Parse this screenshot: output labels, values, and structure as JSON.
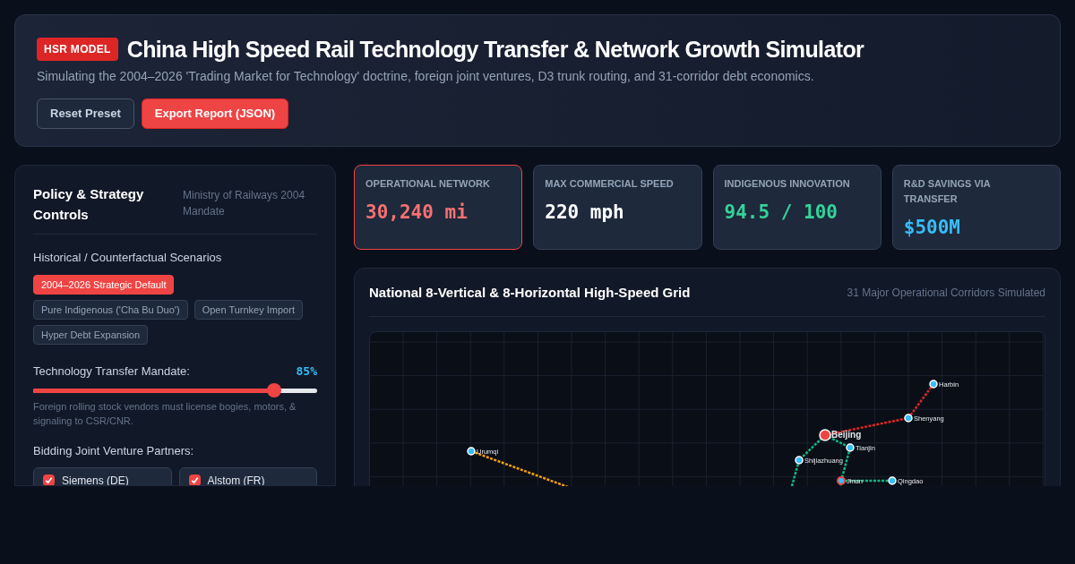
{
  "header": {
    "badge": "HSR MODEL",
    "title": "China High Speed Rail Technology Transfer & Network Growth Simulator",
    "subtitle": "Simulating the 2004–2026 'Trading Market for Technology' doctrine, foreign joint ventures, D3 trunk routing, and 31-corridor debt economics.",
    "buttons": [
      {
        "label": "Reset Preset",
        "kind": "secondary"
      },
      {
        "label": "Export Report (JSON)",
        "kind": "primary"
      }
    ]
  },
  "controls": {
    "title": "Policy & Strategy Controls",
    "subtitle": "Ministry of Railways 2004 Mandate",
    "scenarios_label": "Historical / Counterfactual Scenarios",
    "scenarios": [
      {
        "label": "2004–2026 Strategic Default",
        "selected": true
      },
      {
        "label": "Pure Indigenous ('Cha Bu Duo')",
        "selected": false
      },
      {
        "label": "Open Turnkey Import",
        "selected": false
      },
      {
        "label": "Hyper Debt Expansion",
        "selected": false
      }
    ],
    "mandate": {
      "label": "Technology Transfer Mandate:",
      "reading": "85%",
      "level": 0.85,
      "note": "Foreign rolling stock vendors must license bogies, motors, & signaling to CSR/CNR."
    },
    "partners_label": "Bidding Joint Venture Partners:",
    "partners": [
      {
        "label": "Siemens (DE)",
        "checked": true
      },
      {
        "label": "Alstom (FR)",
        "checked": true
      }
    ]
  },
  "stats": [
    {
      "label": "OPERATIONAL NETWORK",
      "value": "30,240 mi",
      "color": "#f87171",
      "selected": true
    },
    {
      "label": "MAX COMMERCIAL SPEED",
      "value": "220 mph",
      "color": "#ffffff",
      "selected": false
    },
    {
      "label": "INDIGENOUS INNOVATION",
      "value": "94.5 / 100",
      "color": "#34d399",
      "selected": false
    },
    {
      "label": "R&D SAVINGS VIA TRANSFER",
      "value": "$500M",
      "color": "#38bdf8",
      "selected": false
    }
  ],
  "map": {
    "title": "National 8-Vertical & 8-Horizontal High-Speed Grid",
    "subtitle": "31 Major Operational Corridors Simulated",
    "stations": [
      {
        "name": "Harbin",
        "kind": "station"
      },
      {
        "name": "Shenyang",
        "kind": "station"
      },
      {
        "name": "Beijing",
        "kind": "hub"
      },
      {
        "name": "Tianjin",
        "kind": "station"
      },
      {
        "name": "Urumqi",
        "kind": "station"
      },
      {
        "name": "Shijiazhuang",
        "kind": "station"
      },
      {
        "name": "Jinan",
        "kind": "junction"
      },
      {
        "name": "Qingdao",
        "kind": "station"
      }
    ]
  }
}
